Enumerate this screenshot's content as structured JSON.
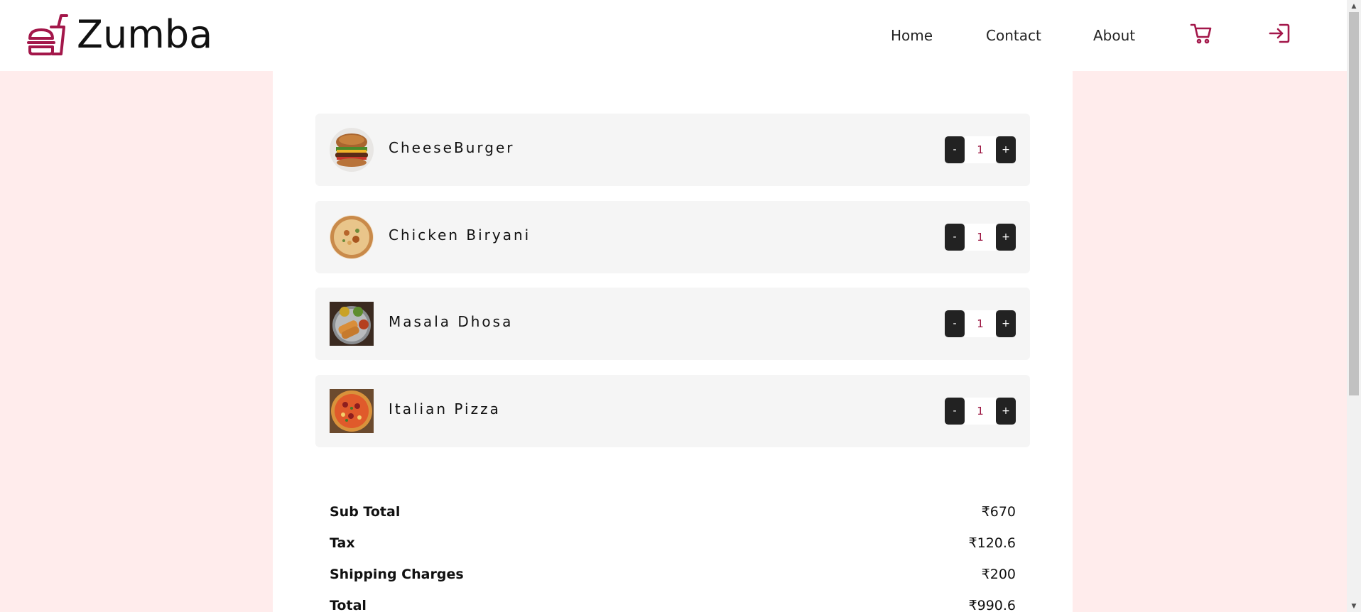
{
  "brand": {
    "name": "Zumba",
    "accent_color": "#a3174a",
    "logo_icon": "food-combo-icon"
  },
  "nav": {
    "home": "Home",
    "contact": "Contact",
    "about": "About",
    "cart_icon": "cart-icon",
    "login_icon": "login-icon"
  },
  "cart": {
    "items": [
      {
        "name": "CheeseBurger",
        "quantity": "1",
        "minus": "-",
        "plus": "+",
        "image": "cheeseburger-image"
      },
      {
        "name": "Chicken Biryani",
        "quantity": "1",
        "minus": "-",
        "plus": "+",
        "image": "chicken-biryani-image"
      },
      {
        "name": "Masala Dhosa",
        "quantity": "1",
        "minus": "-",
        "plus": "+",
        "image": "masala-dhosa-image"
      },
      {
        "name": "Italian Pizza",
        "quantity": "1",
        "minus": "-",
        "plus": "+",
        "image": "italian-pizza-image"
      }
    ]
  },
  "summary": {
    "subtotal_label": "Sub Total",
    "subtotal_value": "₹670",
    "tax_label": "Tax",
    "tax_value": "₹120.6",
    "shipping_label": "Shipping Charges",
    "shipping_value": "₹200",
    "total_label": "Total",
    "total_value": "₹990.6"
  },
  "colors": {
    "page_background": "#ffecec",
    "panel_background": "#ffffff",
    "item_background": "#f5f5f5",
    "button_background": "#222222",
    "quantity_text": "#9b1440"
  }
}
